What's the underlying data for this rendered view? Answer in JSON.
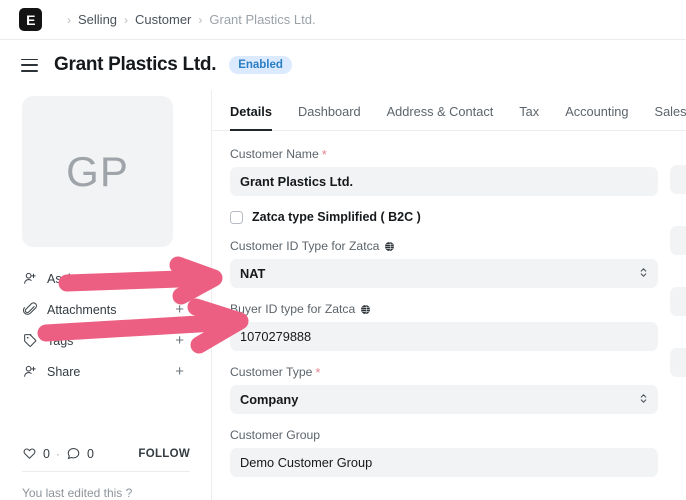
{
  "app": {
    "logo_letter": "E",
    "logo_icon": "erpnext-logo-icon"
  },
  "breadcrumb": {
    "separator": "›",
    "items": [
      {
        "label": "Selling"
      },
      {
        "label": "Customer"
      },
      {
        "label": "Grant Plastics Ltd."
      }
    ]
  },
  "header": {
    "title": "Grant Plastics Ltd.",
    "status_badge": "Enabled",
    "menu_icon": "hamburger-icon",
    "badge_bg": "#dbeafe",
    "badge_color": "#2b7ec4"
  },
  "sidebar": {
    "avatar_initials": "GP",
    "items": [
      {
        "label": "Assigned To",
        "icon": "assign-user-icon",
        "action": "+"
      },
      {
        "label": "Attachments",
        "icon": "paperclip-icon",
        "action": "+"
      },
      {
        "label": "Tags",
        "icon": "tag-icon",
        "action": "+"
      },
      {
        "label": "Share",
        "icon": "share-user-icon",
        "action": "+"
      }
    ],
    "likes_count": "0",
    "comments_count": "0",
    "separator_dot": "·",
    "follow_label": "FOLLOW",
    "edited_note": "You last edited this ?"
  },
  "main": {
    "tabs": [
      {
        "label": "Details",
        "active": true
      },
      {
        "label": "Dashboard",
        "active": false
      },
      {
        "label": "Address & Contact",
        "active": false
      },
      {
        "label": "Tax",
        "active": false
      },
      {
        "label": "Accounting",
        "active": false
      },
      {
        "label": "Sales",
        "active": false
      }
    ],
    "fields": {
      "customer_name": {
        "label": "Customer Name",
        "required": "*",
        "value": "Grant Plastics Ltd."
      },
      "zatca_simplified": {
        "label": "Zatca type Simplified ( B2C )",
        "checked": false
      },
      "customer_id_type": {
        "label": "Customer ID Type for Zatca",
        "value": "NAT",
        "globe": "globe-icon",
        "chevron": "⌃"
      },
      "buyer_id_type": {
        "label": "Buyer ID type for Zatca",
        "value": "1070279888",
        "globe": "globe-icon"
      },
      "customer_type": {
        "label": "Customer Type",
        "required": "*",
        "value": "Company"
      },
      "customer_group": {
        "label": "Customer Group",
        "value": "Demo Customer Group"
      }
    }
  },
  "annotations": {
    "color": "#ec5f82",
    "arrows": [
      {
        "name": "arrow-to-customer-id-type"
      },
      {
        "name": "arrow-to-buyer-id-type"
      }
    ]
  }
}
